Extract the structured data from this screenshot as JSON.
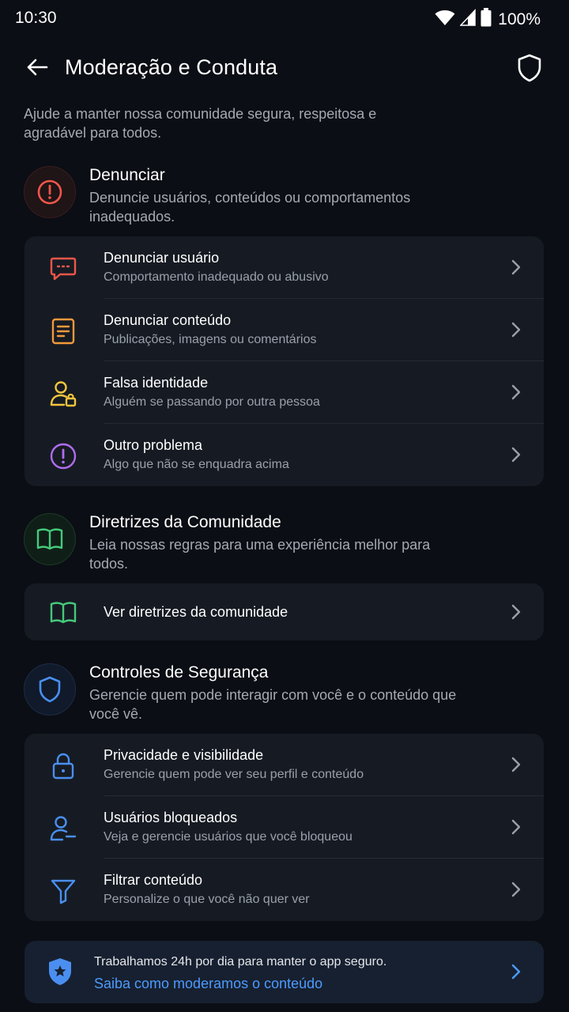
{
  "status_bar": {
    "time": "10:30",
    "battery": "100%"
  },
  "header": {
    "title": "Moderação e Conduta"
  },
  "intro": "Ajude a manter nossa comunidade segura, respeitosa e agradável para todos.",
  "sections": {
    "report": {
      "title": "Denunciar",
      "description": "Denuncie usuários, conteúdos ou comportamentos inadequados.",
      "items": [
        {
          "title": "Denunciar usuário",
          "subtitle": "Comportamento inadequado ou abusivo",
          "icon": "report-user-icon",
          "color": "#f0564a"
        },
        {
          "title": "Denunciar conteúdo",
          "subtitle": "Publicações, imagens ou comentários",
          "icon": "report-content-icon",
          "color": "#f39a3b"
        },
        {
          "title": "Falsa identidade",
          "subtitle": "Alguém se passando por outra pessoa",
          "icon": "fake-identity-icon",
          "color": "#f4c53c"
        },
        {
          "title": "Outro problema",
          "subtitle": "Algo que não se enquadra acima",
          "icon": "other-problem-icon",
          "color": "#b16cf3"
        }
      ]
    },
    "guidelines": {
      "title": "Diretrizes da Comunidade",
      "description": "Leia nossas regras para uma experiência melhor para todos.",
      "items": [
        {
          "title": "Ver diretrizes da comunidade",
          "icon": "book-icon",
          "color": "#46c97a"
        }
      ]
    },
    "safety": {
      "title": "Controles de Segurança",
      "description": "Gerencie quem pode interagir com você e o conteúdo que você vê.",
      "items": [
        {
          "title": "Privacidade e visibilidade",
          "subtitle": "Gerencie quem pode ver seu perfil e conteúdo",
          "icon": "lock-icon",
          "color": "#4a8ff0"
        },
        {
          "title": "Usuários bloqueados",
          "subtitle": "Veja e gerencie usuários que você bloqueou",
          "icon": "blocked-user-icon",
          "color": "#4a8ff0"
        },
        {
          "title": "Filtrar conteúdo",
          "subtitle": "Personalize o que você não quer ver",
          "icon": "filter-icon",
          "color": "#4a8ff0"
        }
      ]
    }
  },
  "footer": {
    "text": "Trabalhamos 24h por dia para manter o app seguro.",
    "link": "Saiba como moderamos o conteúdo"
  },
  "colors": {
    "background": "#0b0e14",
    "card": "#161b23",
    "link": "#4b9bff",
    "danger": "#f0564a",
    "success": "#46c97a",
    "info": "#4a8ff0"
  }
}
